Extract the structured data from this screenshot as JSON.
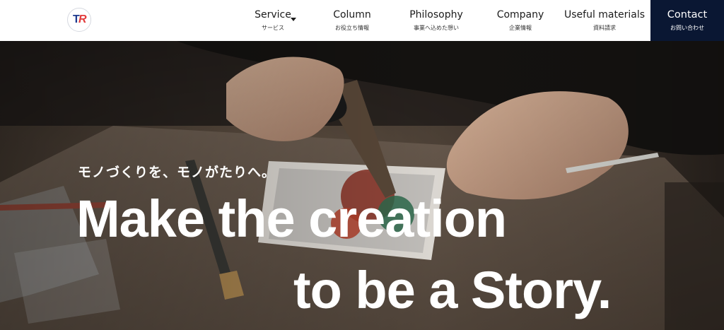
{
  "header": {
    "logo": {
      "letters": [
        "T",
        "R"
      ],
      "brand_colors": [
        "#1f3b8f",
        "#e23b3b"
      ]
    },
    "nav": [
      {
        "label": "Service",
        "sub": "サービス",
        "has_dropdown": true
      },
      {
        "label": "Column",
        "sub": "お役立ち情報"
      },
      {
        "label": "Philosophy",
        "sub": "事業へ込めた想い"
      },
      {
        "label": "Company",
        "sub": "企業情報"
      },
      {
        "label": "Useful materials",
        "sub": "資料請求"
      }
    ],
    "contact": {
      "label": "Contact",
      "sub": "お問い合わせ",
      "color": "#0a1733"
    }
  },
  "hero": {
    "tagline": "モノづくりを、モノがたりへ。",
    "headline_line1": "Make the creation",
    "headline_line2": "to be a Story."
  }
}
